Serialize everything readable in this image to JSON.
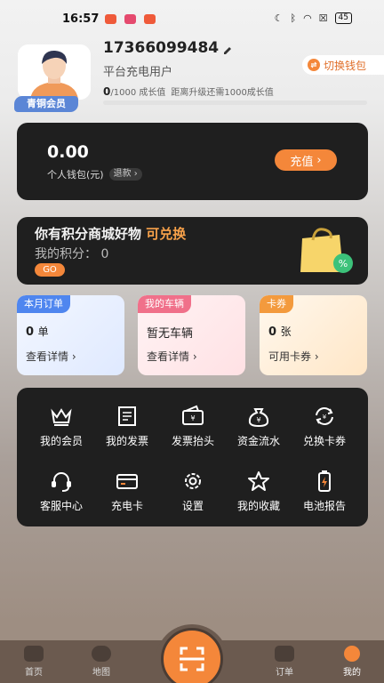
{
  "status_bar": {
    "time": "16:57",
    "battery": "45"
  },
  "profile": {
    "phone": "17366099484",
    "user_type": "平台充电用户",
    "member_badge": "青铜会员",
    "growth_current": "0",
    "growth_total": "/1000 成长值",
    "growth_hint": "距离升级还需1000成长值",
    "growth_progress": 0
  },
  "switch_wallet": {
    "label": "切换钱包"
  },
  "wallet": {
    "amount": "0.00",
    "label": "个人钱包(元)",
    "refund_label": "退款",
    "recharge_label": "充值"
  },
  "points": {
    "headline_prefix": "你有积分商城好物",
    "headline_highlight": "可兑换",
    "my_points_label": "我的积分：",
    "my_points_value": "0",
    "go_label": "GO"
  },
  "cards": [
    {
      "tag": "本月订单",
      "value": "0",
      "unit": "单",
      "action": "查看详情"
    },
    {
      "tag": "我的车辆",
      "value": "暂无车辆",
      "unit": "",
      "action": "查看详情"
    },
    {
      "tag": "卡券",
      "value": "0",
      "unit": "张",
      "action": "可用卡券"
    }
  ],
  "menu": [
    {
      "label": "我的会员",
      "icon": "crown-icon"
    },
    {
      "label": "我的发票",
      "icon": "invoice-icon"
    },
    {
      "label": "发票抬头",
      "icon": "wallet-icon"
    },
    {
      "label": "资金流水",
      "icon": "money-bag-icon"
    },
    {
      "label": "兑换卡券",
      "icon": "exchange-icon"
    },
    {
      "label": "客服中心",
      "icon": "headset-icon"
    },
    {
      "label": "充电卡",
      "icon": "card-icon"
    },
    {
      "label": "设置",
      "icon": "gear-icon"
    },
    {
      "label": "我的收藏",
      "icon": "star-icon"
    },
    {
      "label": "电池报告",
      "icon": "battery-icon"
    }
  ],
  "bottom_nav": [
    {
      "label": "首页"
    },
    {
      "label": "地图"
    },
    {
      "label": "订单"
    },
    {
      "label": "我的"
    }
  ],
  "colors": {
    "accent": "#f4873a",
    "dark_card": "#1f1f1f",
    "member_badge": "#5b86d6"
  }
}
